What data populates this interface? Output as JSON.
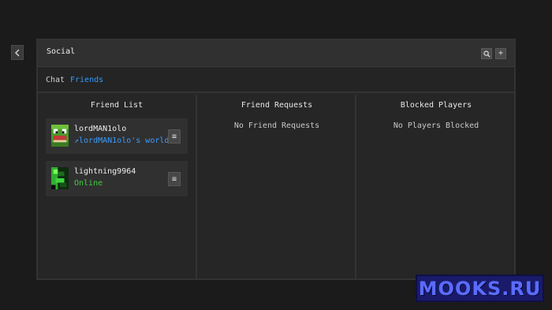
{
  "nav": {
    "back_icon": "chevron-left-icon"
  },
  "header": {
    "title": "Social",
    "search_icon": "search-icon",
    "add_label": "+"
  },
  "tabs": [
    {
      "label": "Chat",
      "active": false
    },
    {
      "label": "Friends",
      "active": true
    }
  ],
  "columns": {
    "friend_list": {
      "title": "Friend List",
      "friends": [
        {
          "name": "lordMAN1olo",
          "status": "↗lordMAN1olo's world",
          "status_color": "#3a9cff",
          "menu_label": "≡"
        },
        {
          "name": "lightning9964",
          "status": "Online",
          "status_color": "#3fcf3f",
          "menu_label": "≡"
        }
      ]
    },
    "friend_requests": {
      "title": "Friend Requests",
      "empty_text": "No Friend Requests"
    },
    "blocked_players": {
      "title": "Blocked Players",
      "empty_text": "No Players Blocked"
    }
  },
  "watermark": {
    "text": "MOOKS.RU"
  },
  "colors": {
    "accent": "#2f9bff",
    "online": "#3fcf3f",
    "panel": "#262626",
    "background": "#1b1b1b"
  }
}
